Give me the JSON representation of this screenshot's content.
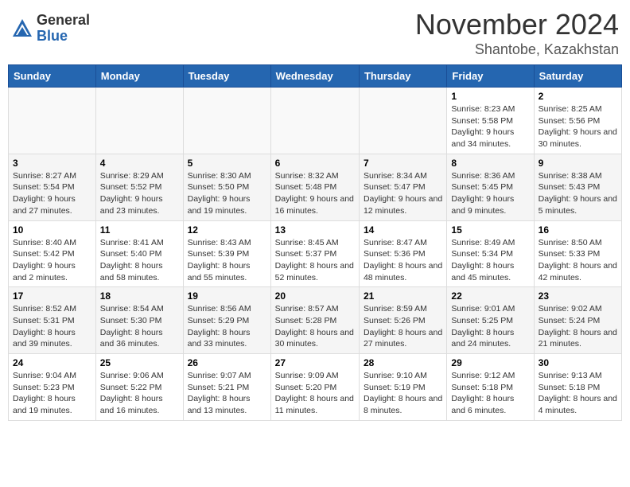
{
  "header": {
    "logo_general": "General",
    "logo_blue": "Blue",
    "month": "November 2024",
    "location": "Shantobe, Kazakhstan"
  },
  "weekdays": [
    "Sunday",
    "Monday",
    "Tuesday",
    "Wednesday",
    "Thursday",
    "Friday",
    "Saturday"
  ],
  "weeks": [
    [
      {
        "day": "",
        "info": ""
      },
      {
        "day": "",
        "info": ""
      },
      {
        "day": "",
        "info": ""
      },
      {
        "day": "",
        "info": ""
      },
      {
        "day": "",
        "info": ""
      },
      {
        "day": "1",
        "info": "Sunrise: 8:23 AM\nSunset: 5:58 PM\nDaylight: 9 hours and 34 minutes."
      },
      {
        "day": "2",
        "info": "Sunrise: 8:25 AM\nSunset: 5:56 PM\nDaylight: 9 hours and 30 minutes."
      }
    ],
    [
      {
        "day": "3",
        "info": "Sunrise: 8:27 AM\nSunset: 5:54 PM\nDaylight: 9 hours and 27 minutes."
      },
      {
        "day": "4",
        "info": "Sunrise: 8:29 AM\nSunset: 5:52 PM\nDaylight: 9 hours and 23 minutes."
      },
      {
        "day": "5",
        "info": "Sunrise: 8:30 AM\nSunset: 5:50 PM\nDaylight: 9 hours and 19 minutes."
      },
      {
        "day": "6",
        "info": "Sunrise: 8:32 AM\nSunset: 5:48 PM\nDaylight: 9 hours and 16 minutes."
      },
      {
        "day": "7",
        "info": "Sunrise: 8:34 AM\nSunset: 5:47 PM\nDaylight: 9 hours and 12 minutes."
      },
      {
        "day": "8",
        "info": "Sunrise: 8:36 AM\nSunset: 5:45 PM\nDaylight: 9 hours and 9 minutes."
      },
      {
        "day": "9",
        "info": "Sunrise: 8:38 AM\nSunset: 5:43 PM\nDaylight: 9 hours and 5 minutes."
      }
    ],
    [
      {
        "day": "10",
        "info": "Sunrise: 8:40 AM\nSunset: 5:42 PM\nDaylight: 9 hours and 2 minutes."
      },
      {
        "day": "11",
        "info": "Sunrise: 8:41 AM\nSunset: 5:40 PM\nDaylight: 8 hours and 58 minutes."
      },
      {
        "day": "12",
        "info": "Sunrise: 8:43 AM\nSunset: 5:39 PM\nDaylight: 8 hours and 55 minutes."
      },
      {
        "day": "13",
        "info": "Sunrise: 8:45 AM\nSunset: 5:37 PM\nDaylight: 8 hours and 52 minutes."
      },
      {
        "day": "14",
        "info": "Sunrise: 8:47 AM\nSunset: 5:36 PM\nDaylight: 8 hours and 48 minutes."
      },
      {
        "day": "15",
        "info": "Sunrise: 8:49 AM\nSunset: 5:34 PM\nDaylight: 8 hours and 45 minutes."
      },
      {
        "day": "16",
        "info": "Sunrise: 8:50 AM\nSunset: 5:33 PM\nDaylight: 8 hours and 42 minutes."
      }
    ],
    [
      {
        "day": "17",
        "info": "Sunrise: 8:52 AM\nSunset: 5:31 PM\nDaylight: 8 hours and 39 minutes."
      },
      {
        "day": "18",
        "info": "Sunrise: 8:54 AM\nSunset: 5:30 PM\nDaylight: 8 hours and 36 minutes."
      },
      {
        "day": "19",
        "info": "Sunrise: 8:56 AM\nSunset: 5:29 PM\nDaylight: 8 hours and 33 minutes."
      },
      {
        "day": "20",
        "info": "Sunrise: 8:57 AM\nSunset: 5:28 PM\nDaylight: 8 hours and 30 minutes."
      },
      {
        "day": "21",
        "info": "Sunrise: 8:59 AM\nSunset: 5:26 PM\nDaylight: 8 hours and 27 minutes."
      },
      {
        "day": "22",
        "info": "Sunrise: 9:01 AM\nSunset: 5:25 PM\nDaylight: 8 hours and 24 minutes."
      },
      {
        "day": "23",
        "info": "Sunrise: 9:02 AM\nSunset: 5:24 PM\nDaylight: 8 hours and 21 minutes."
      }
    ],
    [
      {
        "day": "24",
        "info": "Sunrise: 9:04 AM\nSunset: 5:23 PM\nDaylight: 8 hours and 19 minutes."
      },
      {
        "day": "25",
        "info": "Sunrise: 9:06 AM\nSunset: 5:22 PM\nDaylight: 8 hours and 16 minutes."
      },
      {
        "day": "26",
        "info": "Sunrise: 9:07 AM\nSunset: 5:21 PM\nDaylight: 8 hours and 13 minutes."
      },
      {
        "day": "27",
        "info": "Sunrise: 9:09 AM\nSunset: 5:20 PM\nDaylight: 8 hours and 11 minutes."
      },
      {
        "day": "28",
        "info": "Sunrise: 9:10 AM\nSunset: 5:19 PM\nDaylight: 8 hours and 8 minutes."
      },
      {
        "day": "29",
        "info": "Sunrise: 9:12 AM\nSunset: 5:18 PM\nDaylight: 8 hours and 6 minutes."
      },
      {
        "day": "30",
        "info": "Sunrise: 9:13 AM\nSunset: 5:18 PM\nDaylight: 8 hours and 4 minutes."
      }
    ]
  ]
}
